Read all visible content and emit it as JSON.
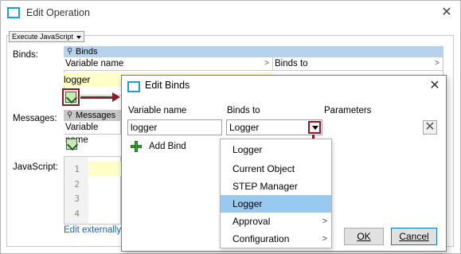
{
  "window": {
    "title": "Edit Operation",
    "close_glyph": "✕"
  },
  "operation_select": {
    "value": "Execute JavaScript"
  },
  "labels": {
    "binds": "Binds:",
    "messages": "Messages:",
    "javascript": "JavaScript:"
  },
  "binds_panel": {
    "header": "Binds",
    "columns": [
      "Variable name",
      "Binds to"
    ],
    "rows": [
      {
        "variable_name": "logger"
      }
    ]
  },
  "messages_panel": {
    "header": "Messages",
    "columns": [
      "Variable name"
    ]
  },
  "javascript_editor": {
    "line_numbers": [
      "1",
      "2",
      "3",
      "4"
    ]
  },
  "edit_externally_link": "Edit externally",
  "edit_binds_dialog": {
    "title": "Edit Binds",
    "close_glyph": "✕",
    "columns": {
      "variable_name": "Variable name",
      "binds_to": "Binds to",
      "parameters": "Parameters"
    },
    "row": {
      "variable_name": "logger",
      "binds_to": "Logger"
    },
    "add_bind_label": "Add Bind",
    "dropdown_options": [
      {
        "label": "Logger",
        "submenu": false,
        "selected": false
      },
      {
        "label": "Current Object",
        "submenu": false,
        "selected": false
      },
      {
        "label": "STEP Manager",
        "submenu": false,
        "selected": false
      },
      {
        "label": "Logger",
        "submenu": false,
        "selected": true
      },
      {
        "label": "Approval",
        "submenu": true,
        "selected": false
      },
      {
        "label": "Configuration",
        "submenu": true,
        "selected": false
      }
    ],
    "ok_label": "OK",
    "cancel_label": "Cancel"
  },
  "colors": {
    "accent_icon": "#1ba1c7",
    "highlight_red": "#8b1a2b",
    "binds_header_bg": "#b8d2ec",
    "selected_option_bg": "#99c9ef",
    "logger_cell_bg": "#ffffc8"
  }
}
